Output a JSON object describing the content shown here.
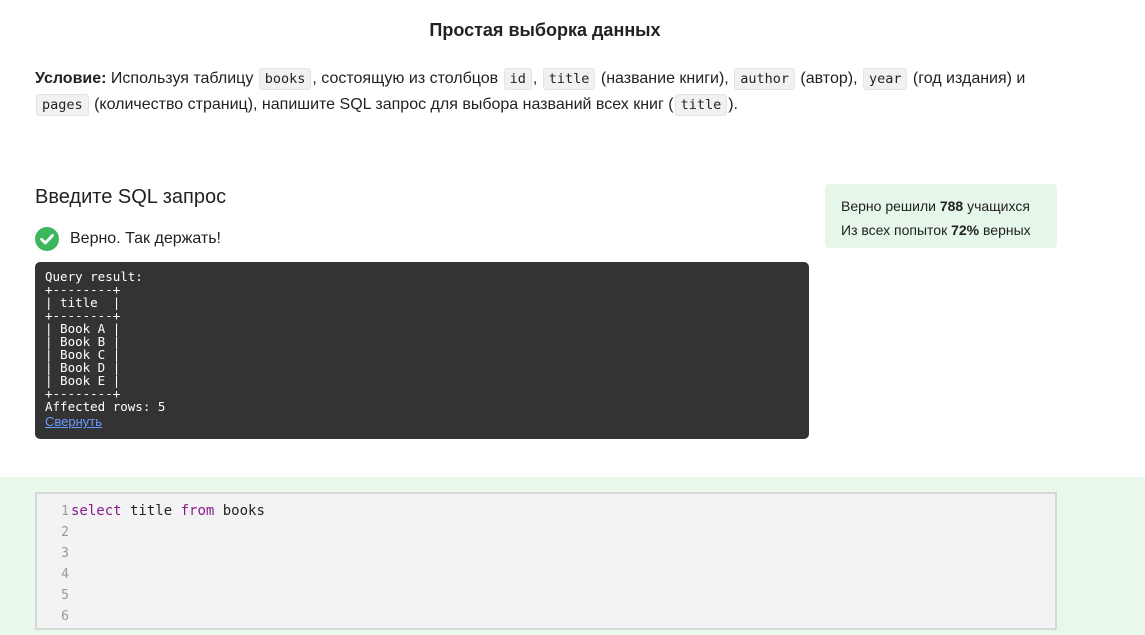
{
  "page": {
    "title": "Простая выборка данных"
  },
  "condition": {
    "label": "Условие:",
    "t1": " Используя таблицу ",
    "c_books": "books",
    "t2": ", состоящую из столбцов ",
    "c_id": "id",
    "t3": ", ",
    "c_title": "title",
    "t4": " (название книги), ",
    "c_author": "author",
    "t5": " (автор), ",
    "c_year": "year",
    "t6": " (год издания) и ",
    "c_pages": "pages",
    "t7": " (количество страниц), напишите SQL запрос для выбора названий всех книг (",
    "c_title2": "title",
    "t8": ")."
  },
  "sql_section": {
    "heading": "Введите SQL запрос",
    "status_text": "Верно. Так держать!"
  },
  "result": {
    "lines": [
      "Query result:",
      "+--------+",
      "| title  |",
      "+--------+",
      "| Book A |",
      "| Book B |",
      "| Book C |",
      "| Book D |",
      "| Book E |",
      "+--------+",
      "Affected rows: 5"
    ],
    "collapse_label": "Свернуть"
  },
  "stats": {
    "solved_prefix": "Верно решили ",
    "solved_count": "788",
    "solved_suffix": " учащихся",
    "attempts_prefix": "Из всех попыток ",
    "attempts_percent": "72%",
    "attempts_suffix": " верных"
  },
  "editor": {
    "line_numbers": [
      "1",
      "2",
      "3",
      "4",
      "5",
      "6"
    ],
    "code": {
      "kw_select": "select",
      "col": " title ",
      "kw_from": "from",
      "table": " books"
    }
  },
  "colors": {
    "success_green": "#3db75e",
    "stats_bg": "#e6f6e9",
    "editor_band_bg": "#e9f8ea",
    "result_bg": "#333333",
    "link_blue": "#6a9cff",
    "keyword_purple": "#8a1b8a"
  }
}
